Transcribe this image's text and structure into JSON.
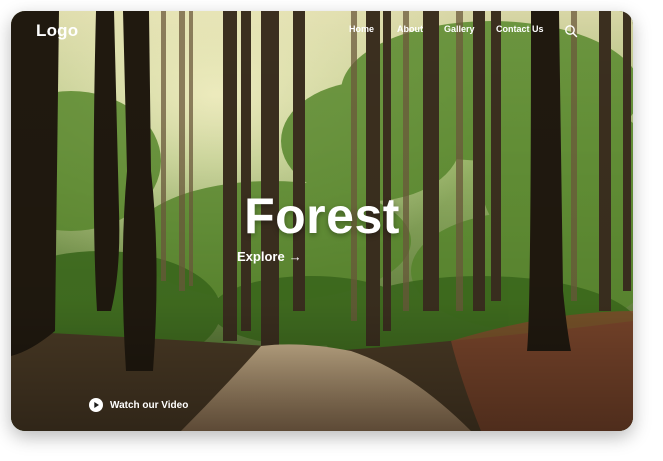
{
  "brand": {
    "logo_text": "Logo"
  },
  "nav": {
    "items": [
      {
        "label": "Home"
      },
      {
        "label": "About"
      },
      {
        "label": "Gallery"
      },
      {
        "label": "Contact Us"
      }
    ]
  },
  "icons": {
    "search": "search-icon",
    "play": "play-icon",
    "arrow": "arrow-right-icon"
  },
  "hero": {
    "title": "Forest",
    "cta_label": "Explore",
    "cta_arrow": "→"
  },
  "video": {
    "label": "Watch our Video"
  },
  "colors": {
    "text": "#ffffff",
    "foliage": "#4f7a2b",
    "trunk": "#2b2418",
    "path": "#b59b7b"
  }
}
